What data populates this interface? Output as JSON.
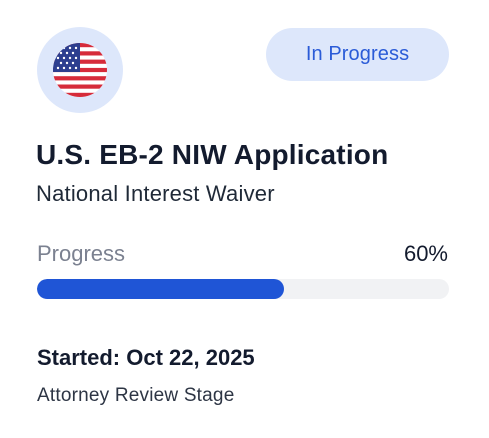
{
  "card": {
    "flag": {
      "icon": "us-flag-icon",
      "badge_color": "#dde7fb"
    },
    "status": {
      "label": "In Progress",
      "text_color": "#2a5bd7",
      "background": "#dde7fb"
    },
    "title": "U.S. EB-2 NIW Application",
    "subtitle": "National Interest Waiver",
    "progress": {
      "label": "Progress",
      "value_text": "60%",
      "fraction": 0.6,
      "fill_color": "#1f55d6",
      "track_color": "#f1f2f4"
    },
    "started": "Started: Oct 22, 2025",
    "stage": "Attorney Review Stage"
  }
}
